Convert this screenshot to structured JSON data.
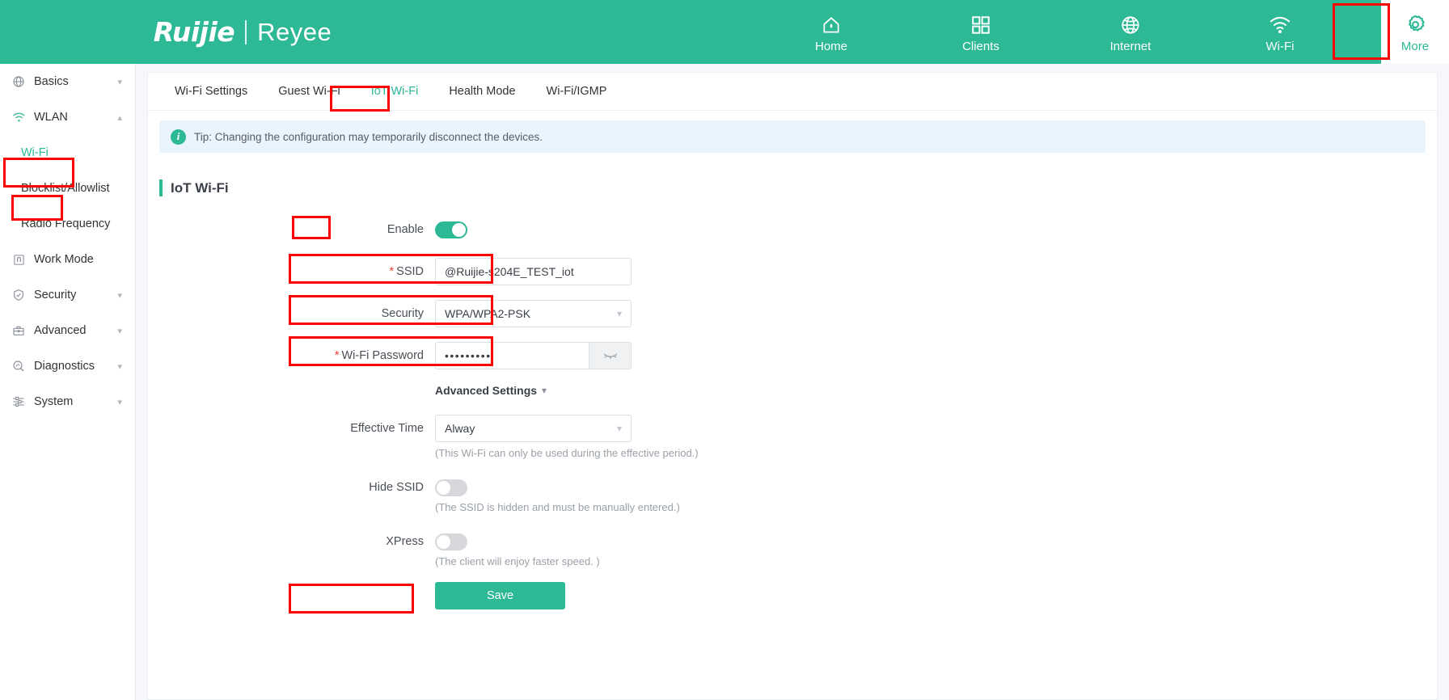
{
  "brand": {
    "ruijie": "Ruijie",
    "reyee": "Reyee"
  },
  "topnav": {
    "items": [
      {
        "label": "Home",
        "icon": "home-icon",
        "active": false
      },
      {
        "label": "Clients",
        "icon": "grid-icon",
        "active": false
      },
      {
        "label": "Internet",
        "icon": "globe-icon",
        "active": false
      },
      {
        "label": "Wi-Fi",
        "icon": "wifi-icon",
        "active": false
      },
      {
        "label": "More",
        "icon": "gear-icon",
        "active": true
      }
    ]
  },
  "sidebar": {
    "items": [
      {
        "label": "Basics",
        "icon": "globe-icon",
        "caret": "down",
        "type": "group"
      },
      {
        "label": "WLAN",
        "icon": "wifi-icon",
        "caret": "up",
        "type": "group",
        "highlighted": true
      },
      {
        "label": "Wi-Fi",
        "icon": "",
        "caret": "",
        "type": "sub",
        "active": true,
        "highlighted": true
      },
      {
        "label": "Blocklist/Allowlist",
        "icon": "",
        "caret": "",
        "type": "sub"
      },
      {
        "label": "Radio Frequency",
        "icon": "",
        "caret": "",
        "type": "sub"
      },
      {
        "label": "Work Mode",
        "icon": "workmode-icon",
        "caret": "",
        "type": "group"
      },
      {
        "label": "Security",
        "icon": "shield-icon",
        "caret": "down",
        "type": "group"
      },
      {
        "label": "Advanced",
        "icon": "toolbox-icon",
        "caret": "down",
        "type": "group"
      },
      {
        "label": "Diagnostics",
        "icon": "diagnostics-icon",
        "caret": "down",
        "type": "group"
      },
      {
        "label": "System",
        "icon": "sliders-icon",
        "caret": "down",
        "type": "group"
      }
    ]
  },
  "tabs": [
    {
      "label": "Wi-Fi Settings",
      "active": false
    },
    {
      "label": "Guest Wi-Fi",
      "active": false
    },
    {
      "label": "IoT Wi-Fi",
      "active": true
    },
    {
      "label": "Health Mode",
      "active": false
    },
    {
      "label": "Wi-Fi/IGMP",
      "active": false
    }
  ],
  "tip": {
    "icon": "info-icon",
    "text": "Tip: Changing the configuration may temporarily disconnect the devices."
  },
  "section": {
    "title": "IoT Wi-Fi"
  },
  "form": {
    "enable": {
      "label": "Enable",
      "value": "on"
    },
    "ssid": {
      "label": "SSID",
      "required": "*",
      "value": "@Ruijie-s204E_TEST_iot"
    },
    "security": {
      "label": "Security",
      "value": "WPA/WPA2-PSK",
      "caret": "chevron-down-icon"
    },
    "password": {
      "label": "Wi-Fi Password",
      "required": "*",
      "value": "•••••••••",
      "reveal_icon": "eye-off-icon"
    },
    "advanced_settings": {
      "label": "Advanced Settings",
      "caret": "chevron-down-icon"
    },
    "effective_time": {
      "label": "Effective Time",
      "value": "Alway",
      "hint": "(This Wi-Fi can only be used during the effective period.)"
    },
    "hide_ssid": {
      "label": "Hide SSID",
      "value": "off",
      "hint": "(The SSID is hidden and must be manually entered.)"
    },
    "xpress": {
      "label": "XPress",
      "value": "off",
      "hint": "(The client will enjoy faster speed. )"
    },
    "save": {
      "label": "Save"
    }
  },
  "colors": {
    "brand_green": "#2db896",
    "highlight_red": "#ff0000",
    "tip_bg": "#eaf4fd",
    "required_red": "#f04134"
  }
}
